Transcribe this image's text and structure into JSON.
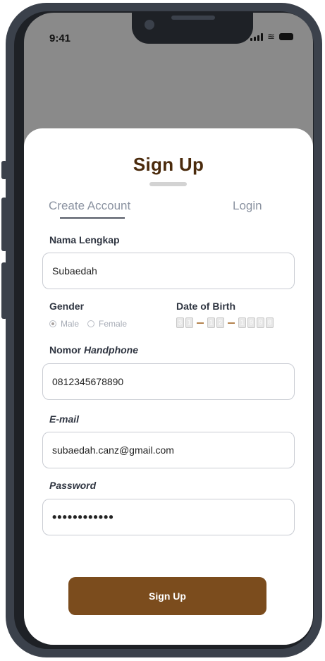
{
  "status_bar": {
    "time": "9:41",
    "wifi_icon": "wifi-icon",
    "battery_icon": "battery-icon",
    "signal_icon": "signal-icon"
  },
  "title": "Sign Up",
  "tabs": {
    "create": "Create Account",
    "login": "Login"
  },
  "form": {
    "name_label": "Nama Lengkap",
    "name_value": "Subaedah",
    "gender_label": "Gender",
    "gender_options": [
      "Male",
      "Female"
    ],
    "gender_selected": "Male",
    "dob_label": "Date of Birth",
    "dob_day": [
      "3",
      "1"
    ],
    "dob_month": [
      "1",
      "2"
    ],
    "dob_year": [
      "1",
      "9",
      "9",
      "8"
    ],
    "phone_label_prefix": "Nomor",
    "phone_label_italic": "Handphone",
    "phone_value": "0812345678890",
    "email_label": "E-mail",
    "email_value": "subaedah.canz@gmail.com",
    "password_label": "Password",
    "password_value": "••••••••••••"
  },
  "submit_label": "Sign Up",
  "colors": {
    "brand": "#7b4c1d",
    "title": "#4a2a0c",
    "accent_dash": "#b4844f"
  }
}
